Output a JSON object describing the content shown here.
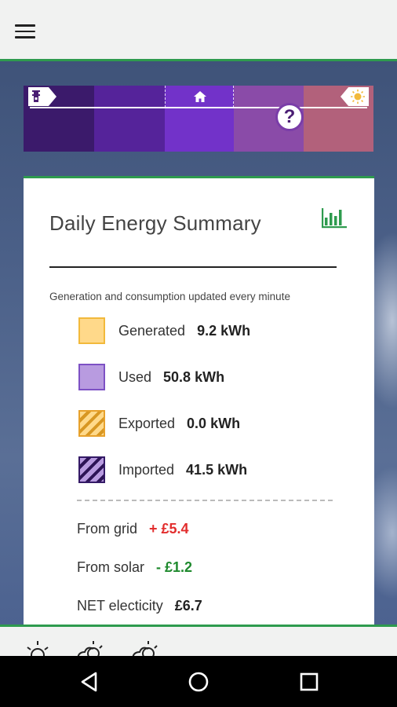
{
  "app": {
    "menu_icon": "hamburger-menu-icon"
  },
  "energy_band": {
    "segments": [
      {
        "name": "night",
        "color": "#3b1a6b"
      },
      {
        "name": "dawn",
        "color": "#55239a"
      },
      {
        "name": "home",
        "color": "#7232c9"
      },
      {
        "name": "afternoon",
        "color": "#8a4ba8"
      },
      {
        "name": "dusk",
        "color": "#b2617b"
      }
    ],
    "left_icon": "moon-tower-icon",
    "center_icon": "home-icon",
    "right_icon": "sun-icon",
    "help_label": "?"
  },
  "card": {
    "title": "Daily Energy Summary",
    "chart_icon": "bar-chart-icon",
    "subtitle": "Generation and consumption updated every minute",
    "legend": [
      {
        "label": "Generated",
        "value": "9.2 kWh"
      },
      {
        "label": "Used",
        "value": "50.8 kWh"
      },
      {
        "label": "Exported",
        "value": "0.0 kWh"
      },
      {
        "label": "Imported",
        "value": "41.5 kWh"
      }
    ],
    "costs": [
      {
        "label": "From grid",
        "value": "+ £5.4",
        "color": "#e22d2d"
      },
      {
        "label": "From solar",
        "value": "- £1.2",
        "color": "#1f8a2e"
      },
      {
        "label": "NET electicity",
        "value": "£6.7",
        "color": "#222222"
      }
    ]
  },
  "weather_strip": {
    "icons": [
      "sunny-icon",
      "partly-cloudy-icon",
      "partly-cloudy-icon"
    ]
  },
  "navbar": {
    "back": "back-icon",
    "home": "home-circle-icon",
    "recents": "recents-icon"
  },
  "colors": {
    "accent_green": "#2e9b4e",
    "generated": "#ffd98a",
    "used": "#b89be0"
  }
}
